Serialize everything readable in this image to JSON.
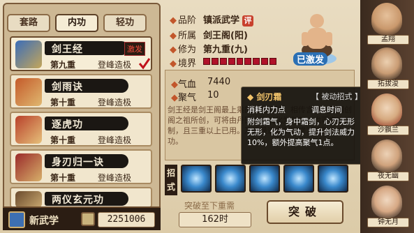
{
  "tabs": [
    {
      "label": "套路",
      "active": false
    },
    {
      "label": "内功",
      "active": true
    },
    {
      "label": "轻功",
      "active": false
    }
  ],
  "skills": [
    {
      "name": "剑王经",
      "level": "第九重",
      "grade": "登峰造极",
      "badge": "激发",
      "selected": true,
      "checked": true
    },
    {
      "name": "剑雨诀",
      "level": "第十重",
      "grade": "登峰造极",
      "badge": "",
      "selected": false,
      "checked": false
    },
    {
      "name": "逐虎功",
      "level": "第十重",
      "grade": "登峰造极",
      "badge": "",
      "selected": false,
      "checked": false
    },
    {
      "name": "身刃归一诀",
      "level": "第十重",
      "grade": "登峰造极",
      "badge": "",
      "selected": false,
      "checked": false
    },
    {
      "name": "两仪玄元功",
      "level": "",
      "grade": "",
      "badge": "",
      "selected": false,
      "checked": false
    }
  ],
  "bottom": {
    "new_skill_label": "新武学",
    "money": "2251006"
  },
  "info": {
    "grade_label": "品阶",
    "grade_value": "镇派武学",
    "grade_tag": "评",
    "owner_label": "所属",
    "owner_value": "剑王阁(阳)",
    "cultivation_label": "修为",
    "cultivation_value": "第九重(九)",
    "realm_label": "境界",
    "realm_filled": 9,
    "activated_label": "已激发"
  },
  "stats": [
    {
      "label": "气血",
      "value": "7440"
    },
    {
      "label": "聚气",
      "value": "10"
    }
  ],
  "description": "剑王经是剑王阁最上乘的内功心法，相传言是剑王阁创阁之祖所创，可将由丹田之真气化为剑气，也可自由控制，且三重以上已用。乃是最适合剑客修习的无上内功。",
  "tooltip": {
    "title": "剑刃霜",
    "type": "【 被动招式 】",
    "cost_label": "消耗内力点",
    "cooldown_label": "调息时间",
    "body": "附剑霜气，身中霜剑，心刃无形无形，化为气动，提升剑法威力10%，额外提高聚气1点。"
  },
  "moves": {
    "label": "招式",
    "count": 5
  },
  "requirement_label": "突破至下重需",
  "requirement_value": "162时",
  "break_button": "突破",
  "roster": [
    {
      "name": "孟翔"
    },
    {
      "name": "拓拔浚"
    },
    {
      "name": "沙飘兰"
    },
    {
      "name": "夜无幽"
    },
    {
      "name": "钟无月"
    }
  ],
  "colors": {
    "accent": "#b0122a",
    "panel": "#cdb894",
    "dark": "#2b1d13"
  }
}
